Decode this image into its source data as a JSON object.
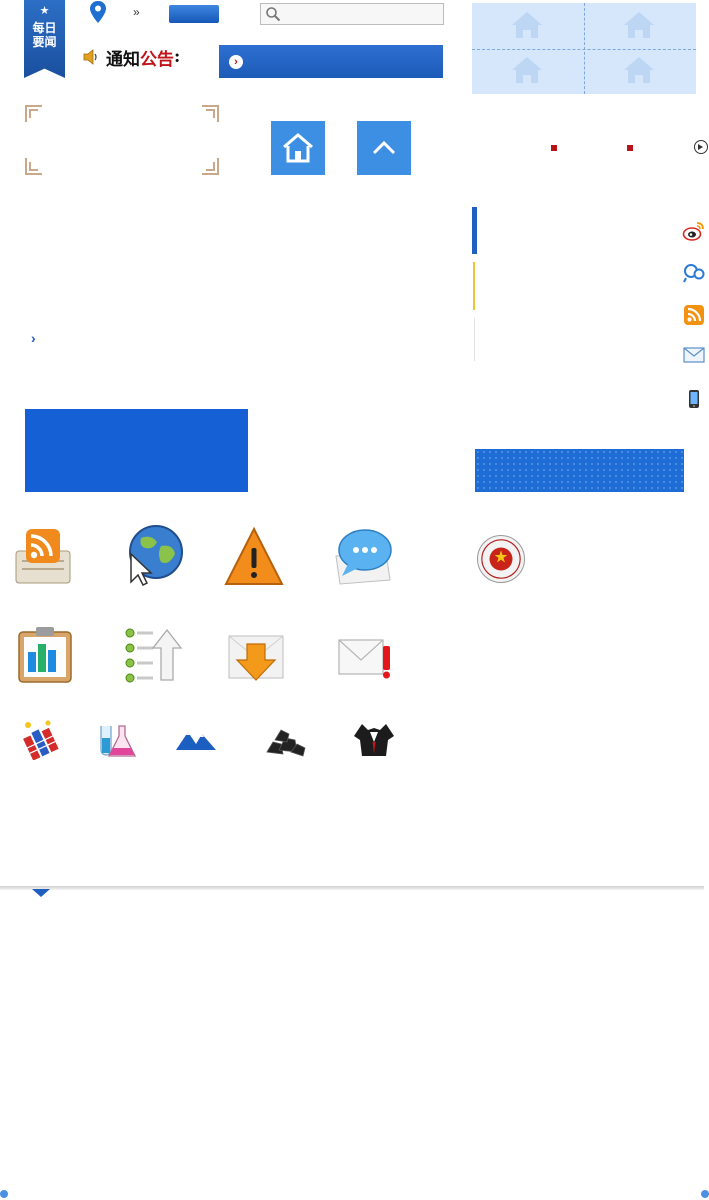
{
  "header": {
    "ribbon_star": "★",
    "ribbon_text_line1": "每日",
    "ribbon_text_line2": "要闻",
    "breadcrumb_sep": "»"
  },
  "notice": {
    "label_part1": "通知",
    "label_part2": "公告",
    "label_colon": ":"
  },
  "noticebar": {
    "arrow": "›"
  },
  "list": {
    "chevron": "›"
  },
  "colors": {
    "brand_blue": "#1560d4",
    "accent_red": "#c0141a",
    "light_blue": "#d6e7fb",
    "tile_blue": "#3d8fe3"
  },
  "icons": {
    "top_row": [
      "location-pin-icon",
      "search-icon",
      "speaker-icon"
    ],
    "house_grid": [
      "house-icon",
      "house-icon",
      "house-icon",
      "house-icon"
    ],
    "tiles": [
      "home-icon",
      "chevron-up-icon"
    ],
    "side": [
      "weibo-icon",
      "qq-icon",
      "rss-icon",
      "mail-icon",
      "mobile-icon"
    ],
    "large_row1": [
      "rss-feed-icon",
      "globe-cursor-icon",
      "warning-icon",
      "chat-bubble-icon"
    ],
    "large_row2": [
      "clipboard-chart-icon",
      "checklist-upload-icon",
      "download-tray-icon",
      "mail-alert-icon"
    ],
    "small_row": [
      "fireworks-icon",
      "flasks-icon",
      "mountains-icon",
      "coal-icon",
      "suit-icon"
    ],
    "emblem": "national-emblem-seal-icon"
  }
}
